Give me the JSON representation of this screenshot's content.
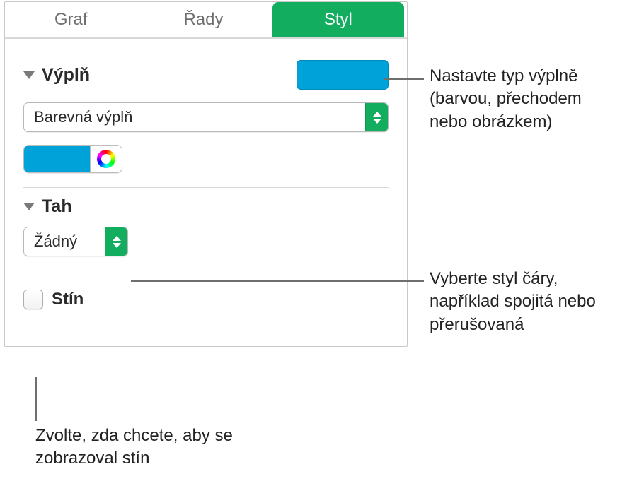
{
  "tabs": {
    "chart": "Graf",
    "series": "Řady",
    "style": "Styl"
  },
  "fill": {
    "title": "Výplň",
    "type_label": "Barevná výplň",
    "color": "#00A3D9"
  },
  "stroke": {
    "title": "Tah",
    "value": "Žádný"
  },
  "shadow": {
    "label": "Stín"
  },
  "callouts": {
    "fill": "Nastavte typ výplně (barvou, přechodem nebo obrázkem)",
    "stroke": "Vyberte styl čáry, například spojitá nebo přerušovaná",
    "shadow": "Zvolte, zda chcete, aby se zobrazoval stín"
  }
}
